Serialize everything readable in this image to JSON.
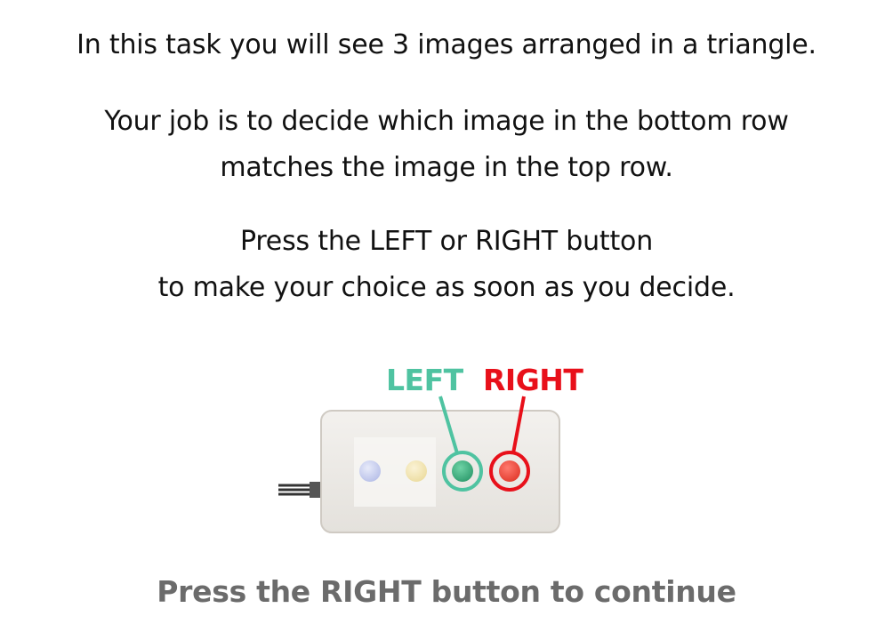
{
  "instructions": {
    "line1": "In this task you will see 3 images arranged in a triangle.",
    "line2": "Your job is to decide which image in the bottom row",
    "line3": "matches the image in the top row.",
    "line4": "Press the LEFT or RIGHT button",
    "line5": "to make your choice as soon as you decide."
  },
  "device": {
    "left_label": "LEFT",
    "right_label": "RIGHT",
    "buttons": [
      "blue",
      "yellow",
      "green",
      "red"
    ]
  },
  "footer": {
    "continue_text": "Press the RIGHT button to continue"
  },
  "colors": {
    "left_accent": "#4fc3a1",
    "right_accent": "#e8101a",
    "continue_text": "#6b6b6b",
    "text": "#111111"
  }
}
